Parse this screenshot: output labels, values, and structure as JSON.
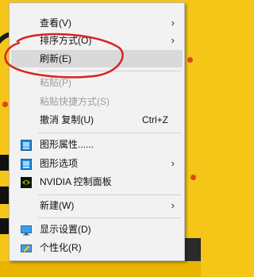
{
  "menu": {
    "items": [
      {
        "id": "view",
        "label": "查看(V)",
        "submenu": true
      },
      {
        "id": "sort",
        "label": "排序方式(O)",
        "submenu": true
      },
      {
        "id": "refresh",
        "label": "刷新(E)",
        "highlighted": true
      },
      {
        "id": "paste",
        "label": "粘贴(P)",
        "disabled": true
      },
      {
        "id": "paste_shortcut",
        "label": "粘贴快捷方式(S)",
        "disabled": true
      },
      {
        "id": "undo",
        "label": "撤消 复制(U)",
        "shortcut": "Ctrl+Z"
      },
      {
        "id": "gfx_props",
        "label": "图形属性......",
        "icon": "graphics-icon"
      },
      {
        "id": "gfx_options",
        "label": "图形选项",
        "icon": "graphics-icon",
        "submenu": true
      },
      {
        "id": "nvidia",
        "label": "NVIDIA 控制面板",
        "icon": "nvidia-icon"
      },
      {
        "id": "new",
        "label": "新建(W)",
        "submenu": true
      },
      {
        "id": "display",
        "label": "显示设置(D)",
        "icon": "display-icon"
      },
      {
        "id": "personalize",
        "label": "个性化(R)",
        "icon": "personalize-icon"
      }
    ]
  },
  "annotation": {
    "shape": "hand-drawn-ellipse",
    "color": "#d9231f",
    "target": "refresh"
  }
}
